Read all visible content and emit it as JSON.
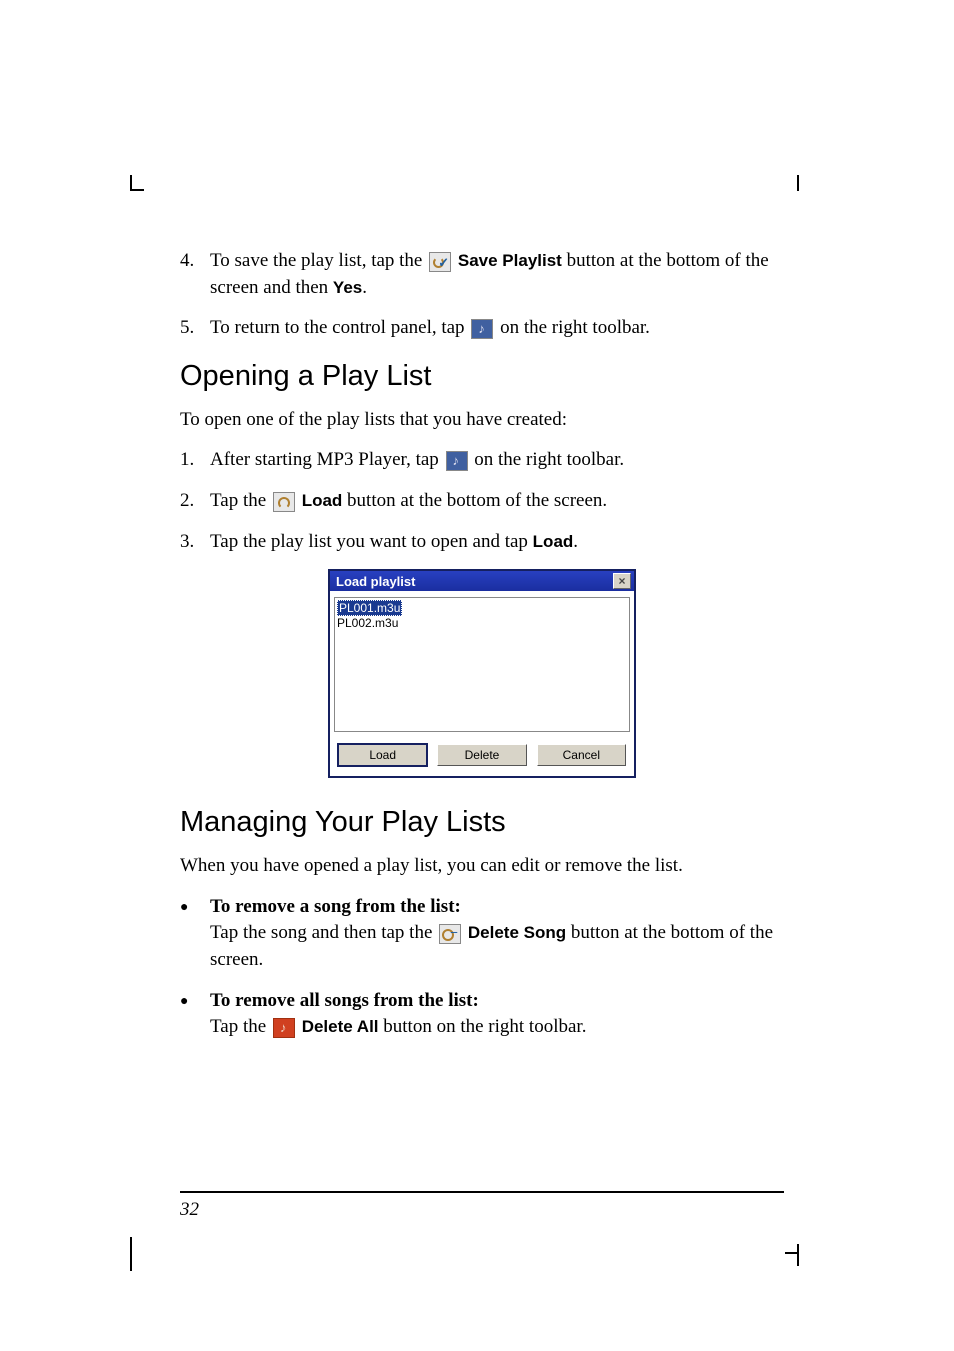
{
  "step4": {
    "num": "4.",
    "t1": "To save the play list, tap the ",
    "btn": "Save Playlist",
    "t2": " button at the bottom of the screen and then ",
    "yes": "Yes",
    "t3": "."
  },
  "step5": {
    "num": "5.",
    "t1": "To return to the control panel, tap ",
    "t2": " on the right toolbar."
  },
  "h_open": "Opening a Play List",
  "p_open": "To open one of the play lists that you have created:",
  "o1": {
    "num": "1.",
    "t1": "After starting MP3 Player, tap ",
    "t2": " on the right toolbar."
  },
  "o2": {
    "num": "2.",
    "t1": "Tap the ",
    "btn": "Load",
    "t2": " button at the bottom of the screen."
  },
  "o3": {
    "num": "3.",
    "t1": "Tap the play list you want to open and tap ",
    "btn": "Load",
    "t2": "."
  },
  "dialog": {
    "title": "Load playlist",
    "close": "×",
    "items": [
      "PL001.m3u",
      "PL002.m3u"
    ],
    "btn_load": "Load",
    "btn_delete": "Delete",
    "btn_cancel": "Cancel"
  },
  "h_manage": "Managing Your Play Lists",
  "p_manage": "When you have opened a play list, you can edit or remove the list.",
  "b1": {
    "head": "To remove a song from the list:",
    "t1": "Tap the song and then tap the ",
    "btn": "Delete Song",
    "t2": " button at the bottom of the screen."
  },
  "b2": {
    "head": "To remove all songs from the list:",
    "t1": "Tap the ",
    "btn": "Delete All",
    "t2": " button on the right toolbar."
  },
  "page_num": "32"
}
